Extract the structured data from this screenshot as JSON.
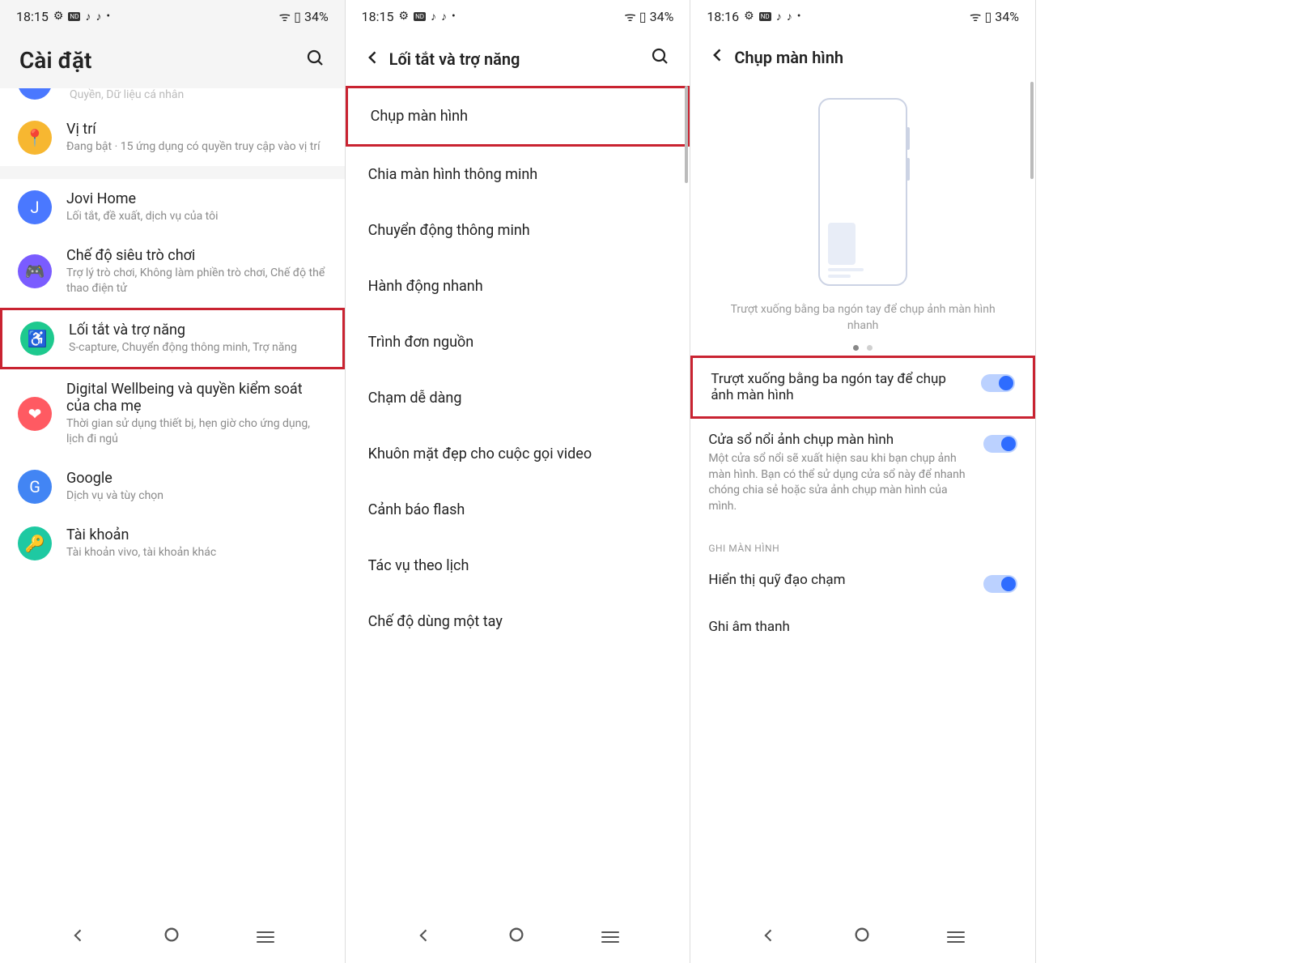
{
  "status_bar": {
    "time_1815": "18:15",
    "time_1816": "18:16",
    "battery": "34%",
    "icons": {
      "gear": "⚙",
      "nd": "ND",
      "tiktok": "♪",
      "tiktok2": "♪",
      "more": "•",
      "wifi": "ᯤ",
      "batt": "▯"
    }
  },
  "screen1": {
    "title": "Cài đặt",
    "peek_sub": "Quyền, Dữ liệu cá nhân",
    "items": [
      {
        "title": "Vị trí",
        "sub": "Đang bật · 15 ứng dụng có quyền truy cập vào vị trí",
        "color": "#f7b731",
        "glyph": "📍"
      },
      {
        "title": "Jovi Home",
        "sub": "Lối tắt, đề xuất, dịch vụ của tôi",
        "color": "#4a78ff",
        "glyph": "J"
      },
      {
        "title": "Chế độ siêu trò chơi",
        "sub": "Trợ lý trò chơi, Không làm phiền trò chơi, Chế độ thể thao điện tử",
        "color": "#7a5cff",
        "glyph": "🎮"
      },
      {
        "title": "Lối tắt và trợ năng",
        "sub": "S-capture, Chuyển động thông minh, Trợ năng",
        "color": "#1ec98e",
        "glyph": "♿",
        "highlight": true
      },
      {
        "title": "Digital Wellbeing và quyền kiểm soát của cha mẹ",
        "sub": "Thời gian sử dụng thiết bị, hẹn giờ cho ứng dụng, lịch đi ngủ",
        "color": "#ff5a62",
        "glyph": "❤"
      },
      {
        "title": "Google",
        "sub": "Dịch vụ và tùy chọn",
        "color": "#4285f4",
        "glyph": "G"
      },
      {
        "title": "Tài khoản",
        "sub": "Tài khoản vivo, tài khoản khác",
        "color": "#1ec9a2",
        "glyph": "🔑"
      }
    ]
  },
  "screen2": {
    "title": "Lối tắt và trợ năng",
    "items": [
      {
        "label": "Chụp màn hình",
        "highlight": true
      },
      {
        "label": "Chia màn hình thông minh"
      },
      {
        "label": "Chuyển động thông minh"
      },
      {
        "label": "Hành động nhanh"
      },
      {
        "label": "Trình đơn nguồn"
      },
      {
        "label": "Chạm dễ dàng"
      },
      {
        "label": "Khuôn mặt đẹp cho cuộc gọi video"
      },
      {
        "label": "Cảnh báo flash"
      },
      {
        "label": "Tác vụ theo lịch"
      },
      {
        "label": "Chế độ dùng một tay"
      }
    ]
  },
  "screen3": {
    "title": "Chụp màn hình",
    "illustration_caption": "Trượt xuống bằng ba ngón tay để chụp ảnh màn hình nhanh",
    "settings": [
      {
        "title": "Trượt xuống bằng ba ngón tay để chụp ảnh màn hình",
        "desc": "",
        "on": true,
        "highlight": true
      },
      {
        "title": "Cửa sổ nổi ảnh chụp màn hình",
        "desc": "Một cửa sổ nổi sẽ xuất hiện sau khi bạn chụp ảnh màn hình. Bạn có thể sử dụng cửa sổ này để nhanh chóng chia sẻ hoặc sửa ảnh chụp màn hình của mình.",
        "on": true
      }
    ],
    "section_header": "GHI MÀN HÌNH",
    "settings2": [
      {
        "title": "Hiển thị quỹ đạo chạm",
        "desc": "",
        "on": true
      },
      {
        "title": "Ghi âm thanh",
        "desc": "",
        "on": false,
        "no_toggle": true
      }
    ]
  }
}
